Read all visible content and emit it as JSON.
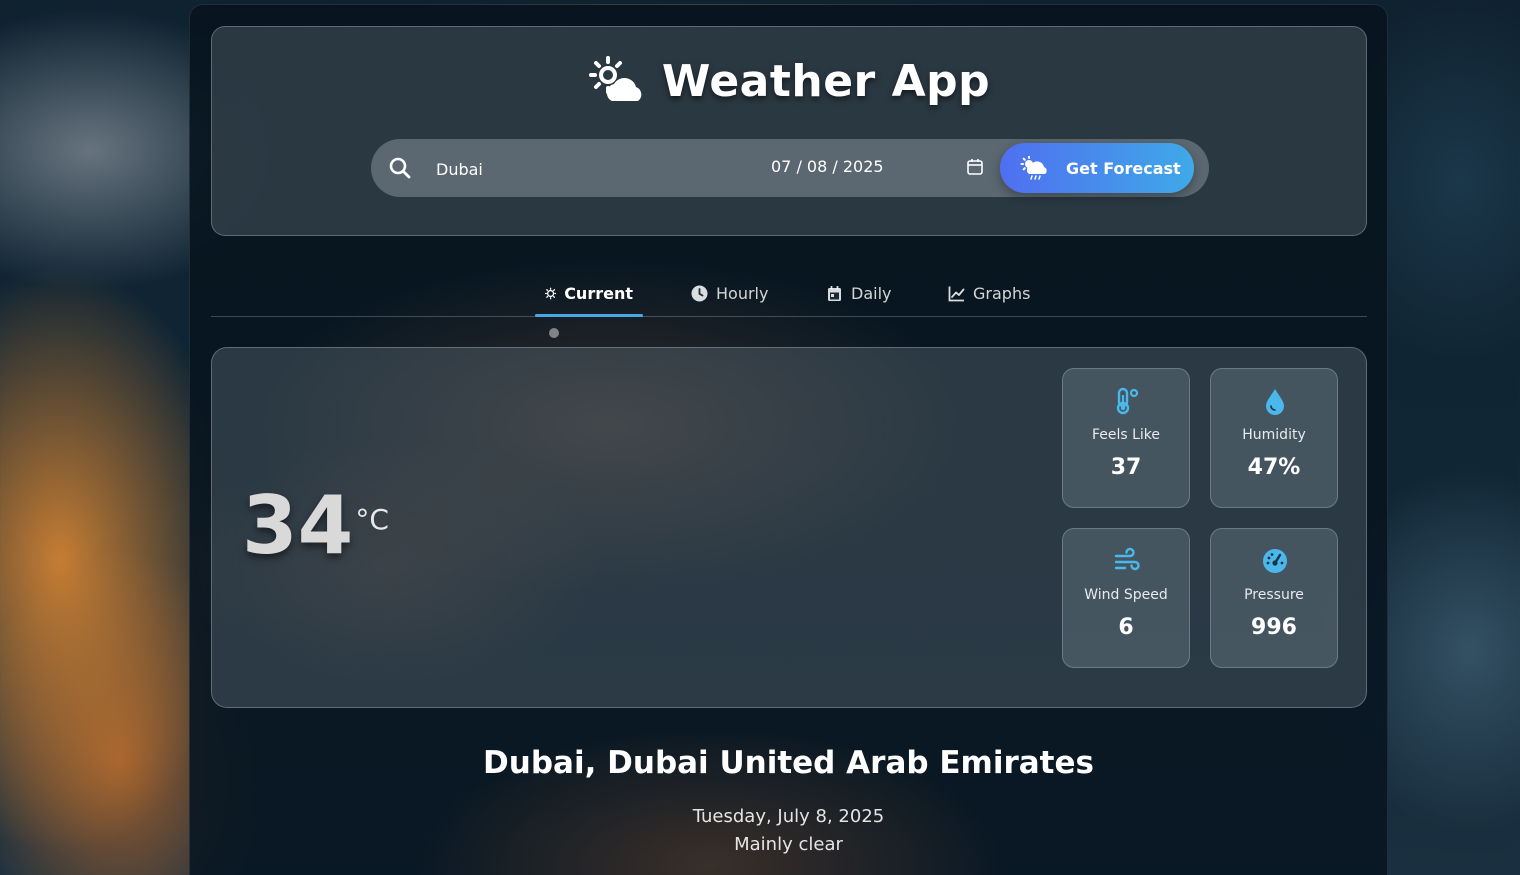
{
  "app": {
    "title": "Weather App",
    "logo_icon": "sun-cloud-icon"
  },
  "search": {
    "city_value": "Dubai",
    "date_value": "07 / 08 / 2025",
    "search_icon": "search-icon",
    "calendar_icon": "calendar-icon",
    "button_label": "Get Forecast",
    "button_icon": "cloud-sun-rain-icon"
  },
  "tabs": [
    {
      "label": "Current",
      "icon": "sun-icon",
      "active": true
    },
    {
      "label": "Hourly",
      "icon": "clock-icon",
      "active": false
    },
    {
      "label": "Daily",
      "icon": "calendar-day-icon",
      "active": false
    },
    {
      "label": "Graphs",
      "icon": "line-chart-icon",
      "active": false
    }
  ],
  "current": {
    "temperature": "34",
    "unit": "°C",
    "stats": [
      {
        "label": "Feels Like",
        "value": "37",
        "icon": "temperature-icon"
      },
      {
        "label": "Humidity",
        "value": "47%",
        "icon": "droplet-icon"
      },
      {
        "label": "Wind Speed",
        "value": "6",
        "icon": "wind-icon"
      },
      {
        "label": "Pressure",
        "value": "996",
        "icon": "gauge-icon"
      }
    ]
  },
  "location": {
    "name": "Dubai, Dubai United Arab Emirates",
    "date": "Tuesday, July 8, 2025",
    "description": "Mainly clear"
  },
  "colors": {
    "accent": "#4aa7e6",
    "button_start": "#4f6ff0",
    "button_end": "#3fa9e8",
    "stat_icon": "#4bb8ec"
  }
}
